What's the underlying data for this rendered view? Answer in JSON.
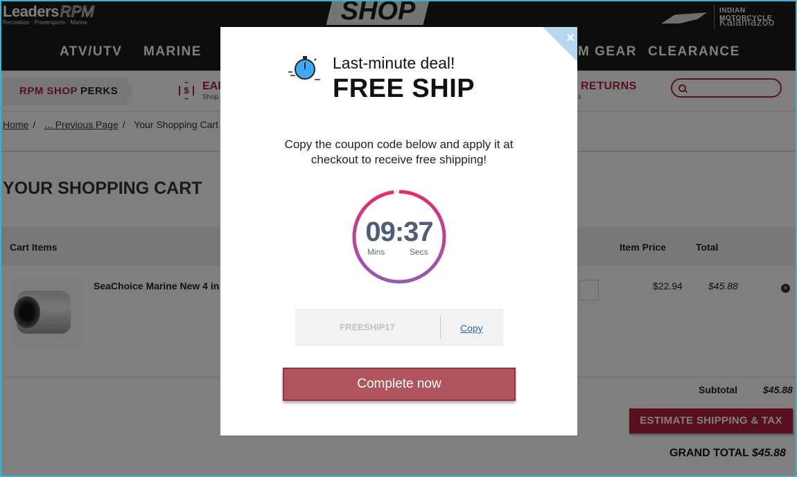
{
  "brand": {
    "left_logo_main": "Leaders",
    "left_logo_accent": "RPM",
    "left_logo_sub": "Recreation · Powersports · Marine",
    "center_logo": "SHOP",
    "right_logo_line1": "INDIAN MOTORCYCLE",
    "right_logo_line2": "Kalamazoo"
  },
  "nav": {
    "items": [
      "ATV/UTV",
      "MARINE",
      "M GEAR",
      "CLEARANCE"
    ]
  },
  "perks": {
    "label_accent": "RPM SHOP",
    "label_main": "PERKS",
    "earn_icon": "$",
    "earn_title": "EAR",
    "earn_sub": "Shop",
    "returns_title": "RETURNS",
    "returns_sub": "s"
  },
  "search": {
    "placeholder": ""
  },
  "breadcrumb": {
    "home": "Home",
    "previous": "... Previous Page",
    "current": "Your Shopping Cart",
    "sep": "/"
  },
  "cart": {
    "title": "YOUR SHOPPING CART",
    "columns": {
      "items": "Cart Items",
      "price": "Item Price",
      "total": "Total"
    },
    "item": {
      "name": "SeaChoice Marine New 4 in",
      "price": "$22.94",
      "total": "$45.88"
    },
    "subtotal_label": "Subtotal",
    "subtotal_value": "$45.88",
    "estimate_button": "ESTIMATE SHIPPING & TAX",
    "grand_total_label": "GRAND TOTAL",
    "grand_total_value": "$45.88"
  },
  "modal": {
    "close": "×",
    "headline": "Last-minute deal!",
    "title": "FREE SHIP",
    "description": "Copy the coupon code below and apply it at checkout to receive free shipping!",
    "timer_time": "09:37",
    "timer_mins_label": "Mins",
    "timer_secs_label": "Secs",
    "timer_remaining_fraction": 0.98,
    "coupon_code": "FREESHIP17",
    "copy_label": "Copy",
    "cta_label": "Complete now",
    "colors": {
      "timer_start": "#8e5bb7",
      "timer_end": "#e8296f",
      "cta": "#b0545e",
      "accent": "#b3213c"
    }
  }
}
